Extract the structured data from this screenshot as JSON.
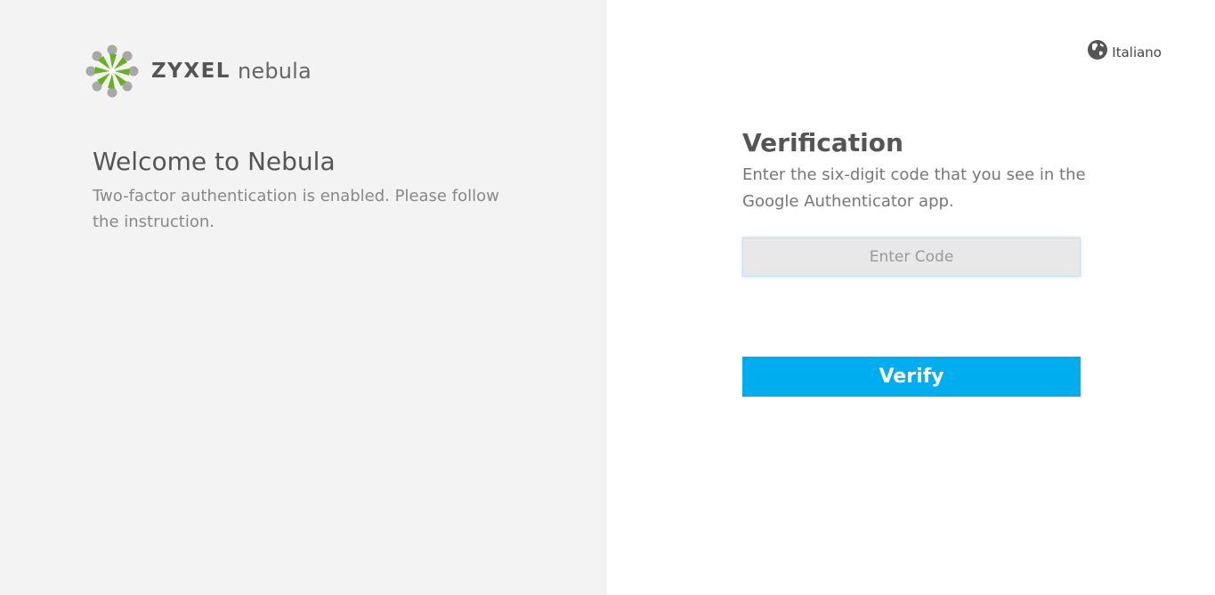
{
  "brand": {
    "logo_icon": "zyxel-nebula-logo-icon",
    "company": "ZYXEL",
    "product": "nebula",
    "colors": {
      "green": "#6ab023",
      "gray": "#a8a8a8"
    }
  },
  "left": {
    "title": "Welcome to Nebula",
    "subtitle": "Two-factor authentication is enabled. Please follow the instruction."
  },
  "language": {
    "icon": "globe-icon",
    "label": "Italiano"
  },
  "verification": {
    "title": "Verification",
    "description": "Enter the six-digit code that you see in the Google Authenticator app.",
    "code_input": {
      "placeholder": "Enter Code",
      "value": ""
    },
    "verify_label": "Verify",
    "accent_color": "#00aeef"
  }
}
